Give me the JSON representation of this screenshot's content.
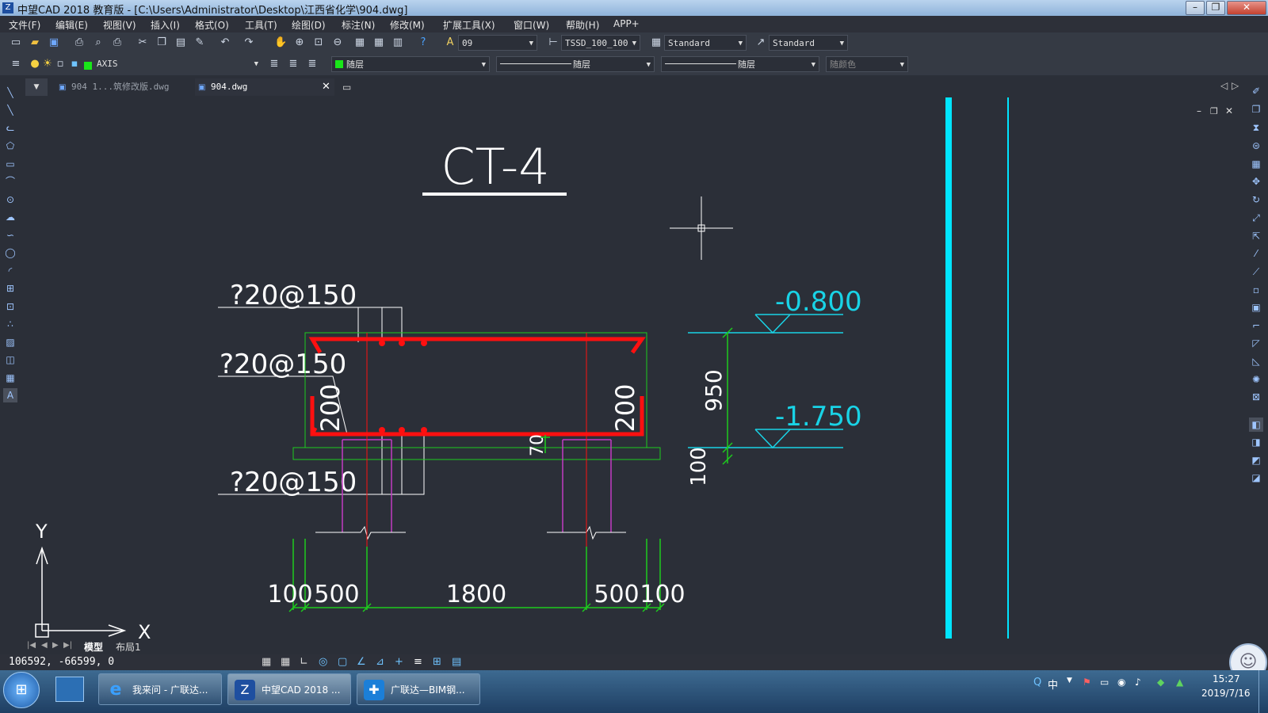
{
  "window": {
    "title": "中望CAD 2018 教育版 - [C:\\Users\\Administrator\\Desktop\\江西省化学\\904.dwg]",
    "controls": {
      "minimize": "–",
      "restore": "❐",
      "close": "✕"
    }
  },
  "menu": [
    "文件(F)",
    "编辑(E)",
    "视图(V)",
    "插入(I)",
    "格式(O)",
    "工具(T)",
    "绘图(D)",
    "标注(N)",
    "修改(M)",
    "扩展工具(X)",
    "窗口(W)",
    "帮助(H)",
    "APP+"
  ],
  "toolbar": {
    "text_style": "09",
    "dim_style": "TSSD_100_100",
    "table_style": "Standard",
    "multileader_style": "Standard",
    "layer": "AXIS",
    "color": "随层",
    "linetype": "随层",
    "lineweight": "随层",
    "plot_style": "随颜色"
  },
  "tabs": [
    {
      "label": "904 1...筑修改版.dwg",
      "active": false
    },
    {
      "label": "904.dwg",
      "active": true
    }
  ],
  "drawing": {
    "title": "CT-4",
    "rebar_labels": [
      "?20@150",
      "?20@150",
      "?20@150"
    ],
    "elevation_top": "-0.800",
    "elevation_bottom": "-1.750",
    "dim_height": "950",
    "dim_cushion": "100",
    "dim_left_side": "200",
    "dim_right_side": "200",
    "dim_small": "70",
    "bottom_dims": [
      "100",
      "500",
      "1800",
      "500",
      "100"
    ],
    "ucs_x": "X",
    "ucs_y": "Y"
  },
  "layout_tabs": [
    "模型",
    "布局1"
  ],
  "status": {
    "coords": "106592, -66599, 0"
  },
  "taskbar": {
    "items": [
      {
        "label": "我来问 - 广联达..."
      },
      {
        "label": "中望CAD 2018 ..."
      },
      {
        "label": "广联达—BIM钢..."
      }
    ],
    "ime": "中",
    "time": "15:27",
    "date": "2019/7/16"
  },
  "colors": {
    "rebar": "#ff1010",
    "dimension": "#1ecb1e",
    "elevation": "#19d3e6",
    "pile": "#c23cc2",
    "axis_line": "#00e5ff"
  }
}
